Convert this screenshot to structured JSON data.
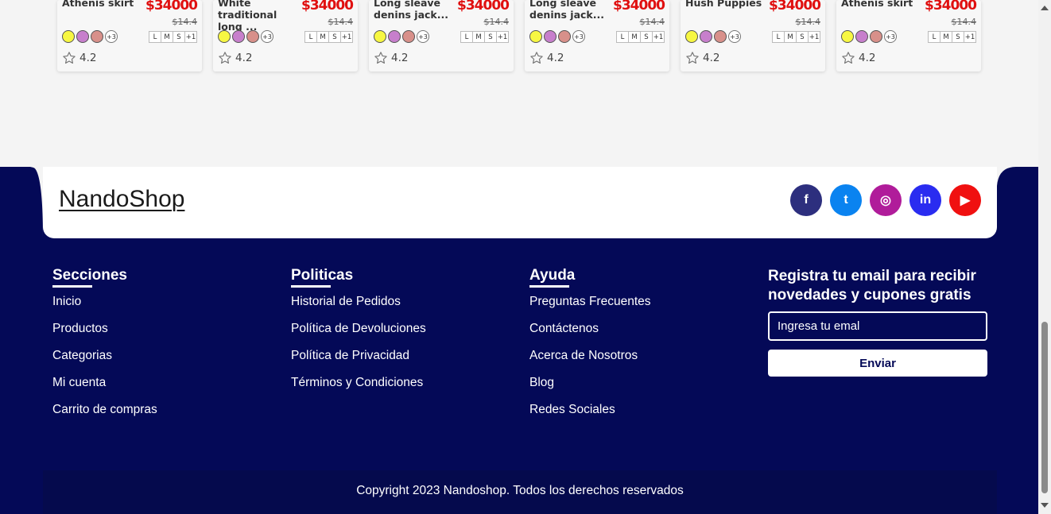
{
  "products": [
    {
      "name": "Athenis skirt",
      "price": "$34000",
      "old_price": "$14.4",
      "rating": "4.2"
    },
    {
      "name": "White traditional\nlong ...",
      "price": "$34000",
      "old_price": "$14.4",
      "rating": "4.2"
    },
    {
      "name": "Long sleave\ndenins jack...",
      "price": "$34000",
      "old_price": "$14.4",
      "rating": "4.2"
    },
    {
      "name": "Long sleave\ndenins jack...",
      "price": "$34000",
      "old_price": "$14.4",
      "rating": "4.2"
    },
    {
      "name": "Hush Puppies",
      "price": "$34000",
      "old_price": "$14.4",
      "rating": "4.2"
    },
    {
      "name": "Athenis skirt",
      "price": "$34000",
      "old_price": "$14.4",
      "rating": "4.2"
    }
  ],
  "swatch_colors": [
    "#f7f742",
    "#c77fcc",
    "#d8908a"
  ],
  "swatch_more": "+3",
  "sizes": [
    "L",
    "M",
    "S",
    "+1"
  ],
  "footer": {
    "brand": "NandoShop",
    "socials": [
      {
        "icon": "facebook-icon",
        "glyph": "f",
        "color": "#2d2f7e"
      },
      {
        "icon": "twitter-icon",
        "glyph": "t",
        "color": "#0a83f0"
      },
      {
        "icon": "instagram-icon",
        "glyph": "◎",
        "color": "#b01c9a"
      },
      {
        "icon": "linkedin-icon",
        "glyph": "in",
        "color": "#2a2cf0"
      },
      {
        "icon": "youtube-icon",
        "glyph": "▶",
        "color": "#f01010"
      }
    ],
    "sections": {
      "title": "Secciones",
      "items": [
        "Inicio",
        "Productos",
        "Categorias",
        "Mi cuenta",
        "Carrito de compras"
      ]
    },
    "policies": {
      "title": "Politicas",
      "items": [
        "Historial de Pedidos",
        "Política de Devoluciones",
        "Política de Privacidad",
        "Términos y Condiciones"
      ]
    },
    "help": {
      "title": "Ayuda",
      "items": [
        "Preguntas Frecuentes",
        "Contáctenos",
        "Acerca de Nosotros",
        "Blog",
        "Redes Sociales"
      ]
    },
    "newsletter": {
      "title": "Registra tu email para recibir novedades y cupones gratis",
      "placeholder": "Ingresa tu emal",
      "button": "Enviar"
    },
    "copyright": "Copyright 2023 Nandoshop. Todos los derechos reservados"
  }
}
